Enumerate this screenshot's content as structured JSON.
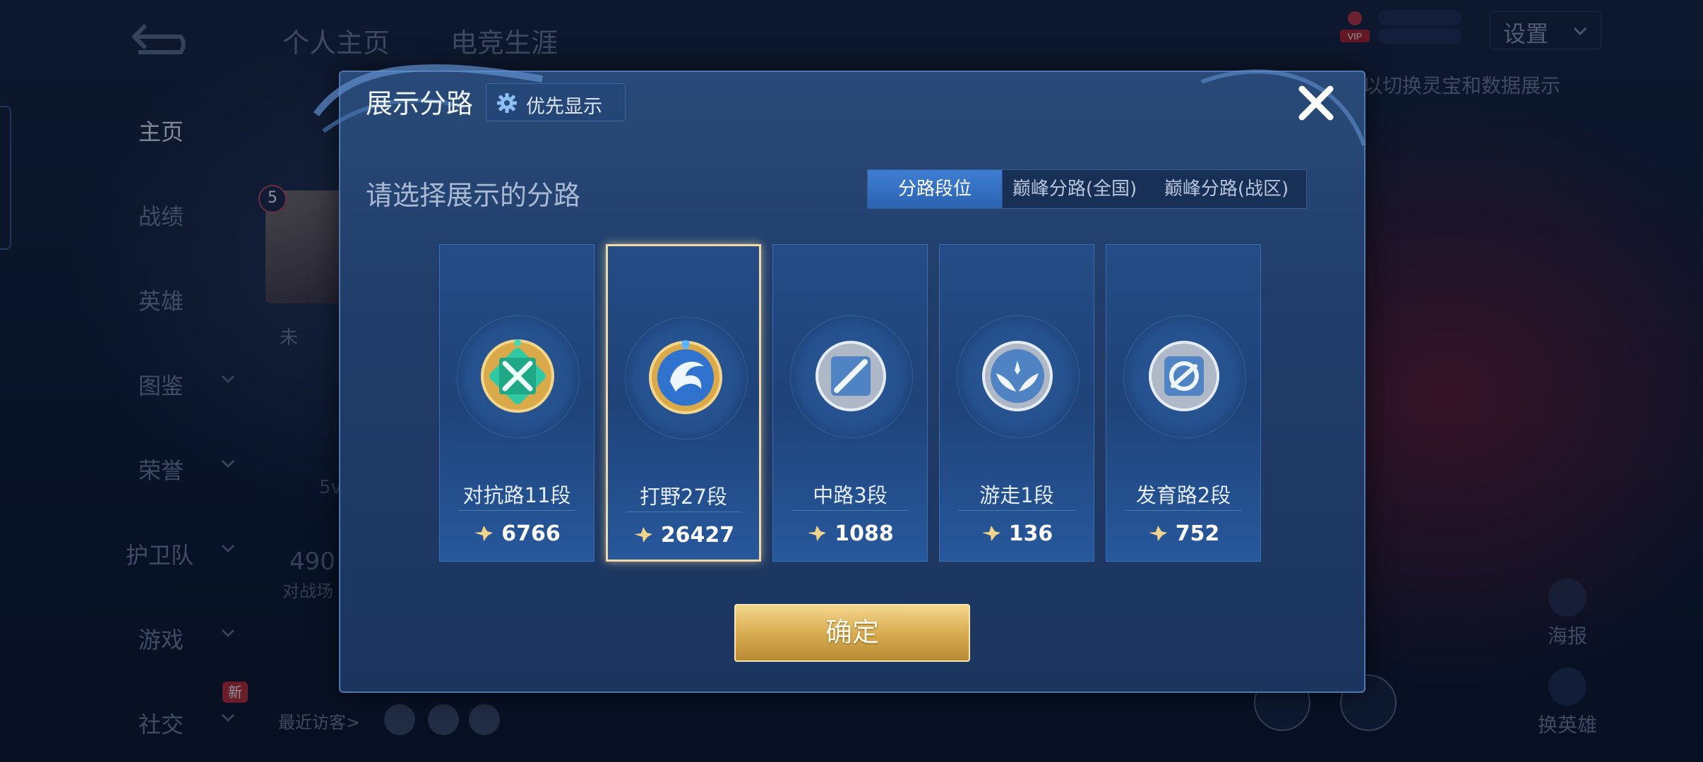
{
  "left_nav": {
    "items": [
      {
        "label": "主页",
        "active": true
      },
      {
        "label": "战绩"
      },
      {
        "label": "英雄"
      },
      {
        "label": "图鉴",
        "has_chevron": true
      },
      {
        "label": "荣誉",
        "has_chevron": true
      },
      {
        "label": "护卫队",
        "has_chevron": true
      },
      {
        "label": "游戏",
        "has_chevron": true
      },
      {
        "label": "社交",
        "has_chevron": true
      }
    ],
    "social_badge": "新"
  },
  "top_tabs": [
    "个人主页",
    "电竞生涯"
  ],
  "settings_label": "设置",
  "vip_label": "VIP",
  "background": {
    "hint_text": "以切换灵宝和数据展示",
    "level_badge": "5",
    "no_rank_text": "未",
    "faded_5v": "5v",
    "faded_number": "490",
    "faded_subtext": "对战场",
    "recent_visitors_label": "最近访客>",
    "side_buttons": [
      "海报",
      "换英雄"
    ]
  },
  "modal": {
    "title": "展示分路",
    "priority_button": "优先显示",
    "subtitle": "请选择展示的分路",
    "segments": [
      "分路段位",
      "巅峰分路(全国)",
      "巅峰分路(战区)"
    ],
    "selected_segment": 0,
    "lanes": [
      {
        "rank": "对抗路11段",
        "score": "6766",
        "emblem": "clash-lane-emblem-icon"
      },
      {
        "rank": "打野27段",
        "score": "26427",
        "emblem": "jungle-emblem-icon",
        "selected": true
      },
      {
        "rank": "中路3段",
        "score": "1088",
        "emblem": "mid-lane-emblem-icon"
      },
      {
        "rank": "游走1段",
        "score": "136",
        "emblem": "roam-emblem-icon"
      },
      {
        "rank": "发育路2段",
        "score": "752",
        "emblem": "farm-lane-emblem-icon"
      }
    ],
    "confirm_label": "确定"
  },
  "colors": {
    "modal_bg": "#203d69",
    "accent_blue": "#3e7ed3",
    "gold": "#d9ad52",
    "selected_border": "#f0d9a8"
  }
}
